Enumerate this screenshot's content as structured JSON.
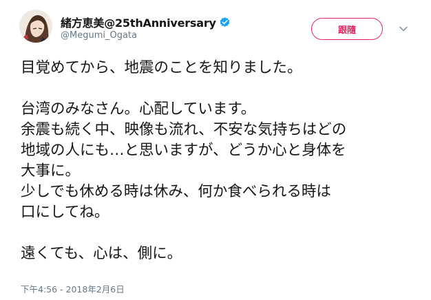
{
  "user": {
    "display_name": "緒方恵美@25thAnniversary",
    "handle": "@Megumi_Ogata",
    "verified": true,
    "verified_color": "#1da1f2"
  },
  "actions": {
    "follow_label": "跟隨",
    "follow_color": "#e0245e",
    "more_icon": "chevron-down-icon"
  },
  "tweet": {
    "paragraphs": [
      [
        "目覚めてから、地震のことを知りました。"
      ],
      [
        "台湾のみなさん。心配しています。",
        "余震も続く中、映像も流れ、不安な気持ちはどの",
        "地域の人にも…と思いますが、どうか心と身体を",
        "大事に。",
        "少しでも休める時は休み、何か食べられる時は",
        "口にしてね。"
      ],
      [
        "遠くても、心は、側に。"
      ]
    ],
    "timestamp": "下午4:56 - 2018年2月6日"
  }
}
